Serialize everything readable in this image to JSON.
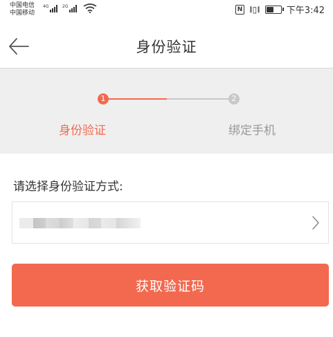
{
  "status_bar": {
    "carrier1": "中国电信",
    "carrier2": "中国移动",
    "net1": "4G",
    "net2": "2G",
    "nfc": "N",
    "time": "下午3:42",
    "battery_level": 0.45
  },
  "header": {
    "title": "身份验证"
  },
  "steps": [
    {
      "number": "1",
      "label": "身份验证",
      "active": true
    },
    {
      "number": "2",
      "label": "绑定手机",
      "active": false
    }
  ],
  "form": {
    "prompt": "请选择身份验证方式:",
    "method_value": ""
  },
  "submit": {
    "label": "获取验证码"
  },
  "colors": {
    "accent": "#f2694f",
    "inactive": "#c8c8c8",
    "steps_bg": "#efefef"
  },
  "icons": {
    "back": "back-arrow-icon",
    "chevron": "chevron-right-icon",
    "wifi": "wifi-icon",
    "battery": "battery-icon",
    "vibrate": "vibrate-icon",
    "nfc": "nfc-icon"
  }
}
